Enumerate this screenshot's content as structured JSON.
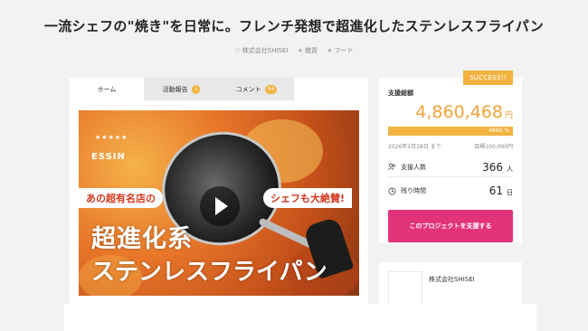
{
  "project": {
    "title": "一流シェフの\"焼き\"を日常に。フレンチ発想で超進化したステンレスフライパン",
    "owner": "株式会社SHISEI",
    "categories": [
      "雑貨",
      "フード"
    ]
  },
  "tabs": [
    {
      "label": "ホーム",
      "badge": ""
    },
    {
      "label": "活動報告",
      "badge": "1"
    },
    {
      "label": "コメント",
      "badge": "94"
    }
  ],
  "hero": {
    "stars": "★★★★★",
    "logo": "ESSIN",
    "caption_left": "あの超有名店の",
    "caption_right": "シェフも大絶賛!",
    "headline_1": "超進化系",
    "headline_2": "ステンレスフライパン"
  },
  "funding": {
    "status": "SUCCESS!!",
    "label": "支援総額",
    "amount": "4,860,468",
    "amount_unit": "円",
    "progress_percent": 4860,
    "progress_text": "4860 %",
    "deadline": "2026年2月28日 まで",
    "goal": "目標100,000円",
    "supporters_label": "支援人数",
    "supporters": "366",
    "supporters_unit": "人",
    "remaining_label": "残り時間",
    "remaining": "61",
    "remaining_unit": "日",
    "support_button": "このプロジェクトを支援する"
  },
  "colors": {
    "accent": "#f2b340",
    "amount": "#f2a33a",
    "support_button": "#e2337a"
  }
}
